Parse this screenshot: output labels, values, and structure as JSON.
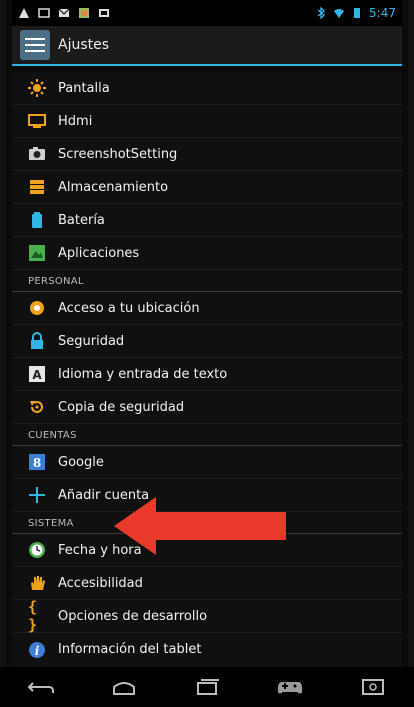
{
  "status_bar": {
    "time": "5:47",
    "colors": {
      "accent": "#33b5e5"
    }
  },
  "action_bar": {
    "title": "Ajustes"
  },
  "sections": [
    {
      "header": "",
      "items": [
        {
          "label": "Pantalla",
          "icon": "brightness-icon",
          "color": "#f0a21b"
        },
        {
          "label": "Hdmi",
          "icon": "monitor-icon",
          "color": "#f0a21b"
        },
        {
          "label": "ScreenshotSetting",
          "icon": "camera-icon",
          "color": "#ccc"
        },
        {
          "label": "Almacenamiento",
          "icon": "storage-icon",
          "color": "#f0a21b"
        },
        {
          "label": "Batería",
          "icon": "battery-icon",
          "color": "#33b5e5"
        },
        {
          "label": "Aplicaciones",
          "icon": "apps-icon",
          "color": "#4caf50"
        }
      ]
    },
    {
      "header": "PERSONAL",
      "items": [
        {
          "label": "Acceso a tu ubicación",
          "icon": "location-icon",
          "color": "#f0a21b"
        },
        {
          "label": "Seguridad",
          "icon": "lock-icon",
          "color": "#33b5e5"
        },
        {
          "label": "Idioma y entrada de texto",
          "icon": "keyboard-icon",
          "color": "#ddd"
        },
        {
          "label": "Copia de seguridad",
          "icon": "backup-icon",
          "color": "#f0a21b"
        }
      ]
    },
    {
      "header": "CUENTAS",
      "items": [
        {
          "label": "Google",
          "icon": "google-icon",
          "color": "#3d7fd6"
        },
        {
          "label": "Añadir cuenta",
          "icon": "plus-icon",
          "color": "#33b5e5"
        }
      ]
    },
    {
      "header": "SISTEMA",
      "items": [
        {
          "label": "Fecha y hora",
          "icon": "clock-icon",
          "color": "#4caf50"
        },
        {
          "label": "Accesibilidad",
          "icon": "hand-icon",
          "color": "#f0a21b"
        },
        {
          "label": "Opciones de desarrollo",
          "icon": "braces-icon",
          "color": "#f0a21b"
        },
        {
          "label": "Información del tablet",
          "icon": "info-icon",
          "color": "#3d7fd6"
        }
      ]
    }
  ],
  "arrow_color": "#e8392b"
}
